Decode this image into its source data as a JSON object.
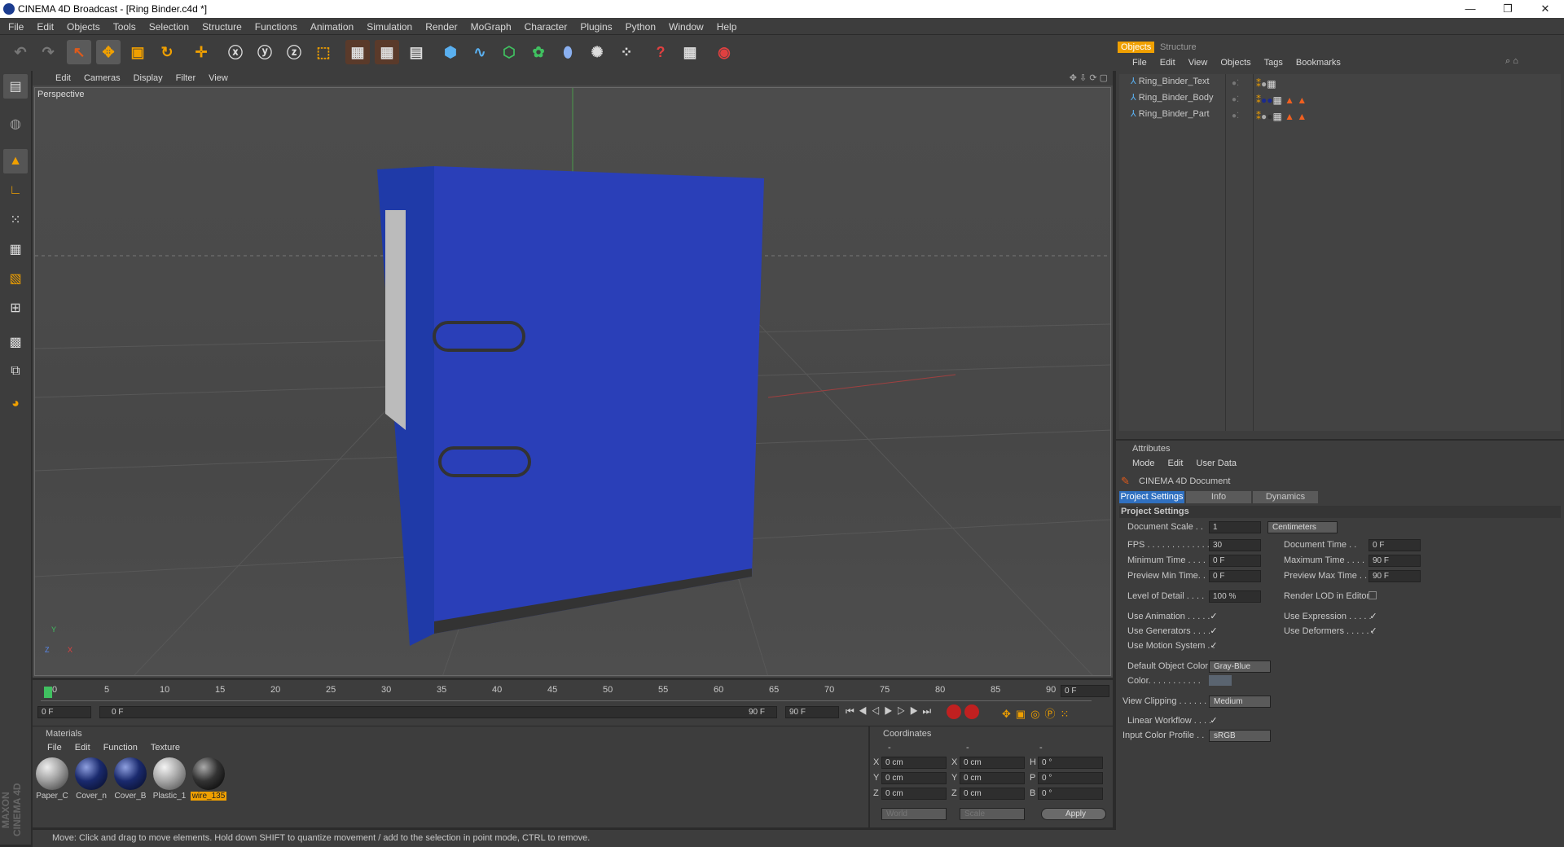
{
  "window": {
    "title": "CINEMA 4D Broadcast - [Ring Binder.c4d *]",
    "minimize": "—",
    "restore": "❐",
    "close": "✕"
  },
  "menubar": [
    "File",
    "Edit",
    "Objects",
    "Tools",
    "Selection",
    "Structure",
    "Functions",
    "Animation",
    "Simulation",
    "Render",
    "MoGraph",
    "Character",
    "Plugins",
    "Python",
    "Window",
    "Help"
  ],
  "viewport": {
    "menu": [
      "Edit",
      "Cameras",
      "Display",
      "Filter",
      "View"
    ],
    "label": "Perspective",
    "axis_y": "Y",
    "axis_z": "Z",
    "axis_x": "X"
  },
  "timeline": {
    "ticks": [
      "0",
      "5",
      "10",
      "15",
      "20",
      "25",
      "30",
      "35",
      "40",
      "45",
      "50",
      "55",
      "60",
      "65",
      "70",
      "75",
      "80",
      "85",
      "90"
    ],
    "current_frame": "0 F",
    "start": "0 F",
    "range_start": "0 F",
    "range_end": "90 F",
    "end": "90 F"
  },
  "materials": {
    "title": "Materials",
    "menu": [
      "File",
      "Edit",
      "Function",
      "Texture"
    ],
    "items": [
      {
        "name": "Paper_C",
        "color": "#a8a8a8"
      },
      {
        "name": "Cover_n",
        "color": "#1a2a6e"
      },
      {
        "name": "Cover_B",
        "color": "#1a2a6e"
      },
      {
        "name": "Plastic_1",
        "color": "#b0b0b0"
      },
      {
        "name": "wire_135",
        "color": "#333333",
        "selected": true
      }
    ]
  },
  "coordinates": {
    "title": "Coordinates",
    "header": [
      "-",
      "-",
      "-"
    ],
    "rows": [
      {
        "a": "X",
        "av": "0 cm",
        "b": "X",
        "bv": "0 cm",
        "c": "H",
        "cv": "0 °"
      },
      {
        "a": "Y",
        "av": "0 cm",
        "b": "Y",
        "bv": "0 cm",
        "c": "P",
        "cv": "0 °"
      },
      {
        "a": "Z",
        "av": "0 cm",
        "b": "Z",
        "bv": "0 cm",
        "c": "B",
        "cv": "0 °"
      }
    ],
    "mode1": "World",
    "mode2": "Scale",
    "apply": "Apply"
  },
  "status": "Move: Click and drag to move elements. Hold down SHIFT to quantize movement / add to the selection in point mode, CTRL to remove.",
  "brand": "MAXON CINEMA 4D",
  "objects": {
    "tabs": [
      "Objects",
      "Structure"
    ],
    "menu": [
      "File",
      "Edit",
      "View",
      "Objects",
      "Tags",
      "Bookmarks"
    ],
    "items": [
      "Ring_Binder_Text",
      "Ring_Binder_Body",
      "Ring_Binder_Part"
    ]
  },
  "attributes": {
    "title": "Attributes",
    "menu": [
      "Mode",
      "Edit",
      "User Data"
    ],
    "doc": "CINEMA 4D Document",
    "tabs": [
      "Project Settings",
      "Info",
      "Dynamics"
    ],
    "section": "Project Settings",
    "document_scale_label": "Document Scale . .",
    "document_scale": "1",
    "units": "Centimeters",
    "fps_label": "FPS . . . . . . . . . . . . .",
    "fps": "30",
    "doctime_label": "Document Time . .",
    "doctime": "0 F",
    "mintime_label": "Minimum Time . . . .",
    "mintime": "0 F",
    "maxtime_label": "Maximum Time . . . .",
    "maxtime": "90 F",
    "prevmin_label": "Preview Min Time. .",
    "prevmin": "0 F",
    "prevmax_label": "Preview Max Time . .",
    "prevmax": "90 F",
    "lod_label": "Level of Detail . . . .",
    "lod": "100 %",
    "renderlod_label": "Render LOD in Editor",
    "use_anim": "Use Animation . . . . .",
    "use_expr": "Use Expression . . . . .",
    "use_gen": "Use Generators . . . .",
    "use_def": "Use Deformers . . . . . .",
    "use_motion": "Use Motion System . .",
    "defcolor_label": "Default Object Color",
    "defcolor": "Gray-Blue",
    "color_label": "Color. . . . . . . . . . .",
    "viewclip_label": "View Clipping . . . . . .",
    "viewclip": "Medium",
    "linear_label": "Linear Workflow . . . .",
    "icp_label": "Input Color Profile . .",
    "icp": "sRGB"
  }
}
